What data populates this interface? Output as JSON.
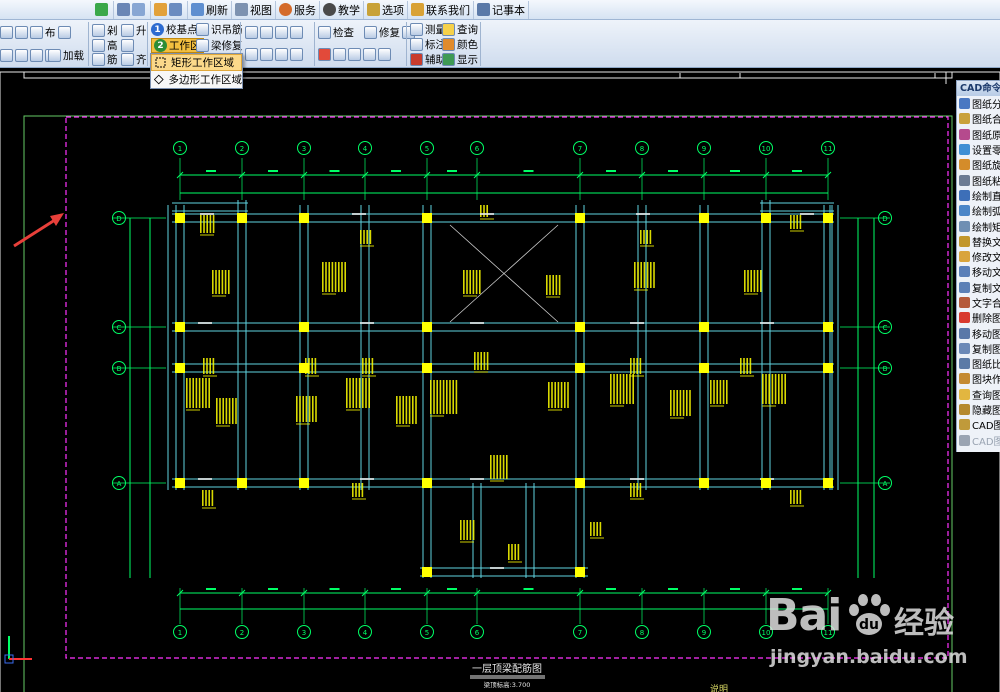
{
  "menubar": {
    "items": [
      {
        "label": "",
        "icon": "puzzle-icon"
      },
      {
        "label": "",
        "icon": "dimension-icon"
      },
      {
        "label": "",
        "icon": "window-icon"
      },
      {
        "label": "",
        "icon": "pencil-icon"
      },
      {
        "label": "刷新",
        "icon": "refresh-icon"
      },
      {
        "label": "视图",
        "icon": "view-icon"
      },
      {
        "label": "服务",
        "icon": "service-icon"
      },
      {
        "label": "教学",
        "icon": "teaching-icon"
      },
      {
        "label": "选项",
        "icon": "options-icon"
      },
      {
        "label": "联系我们",
        "icon": "contact-icon"
      },
      {
        "label": "记事本",
        "icon": "notepad-icon"
      }
    ]
  },
  "ribbon": {
    "group1": {
      "row1": [
        "剁",
        "升"
      ],
      "row2": [
        "高",
        "加载"
      ],
      "row3": [
        "筋",
        "齐"
      ]
    },
    "steps": {
      "step1": {
        "num": "1",
        "label": "校基点"
      },
      "step2": {
        "num": "2",
        "label": "工作区"
      },
      "recognize": "识吊筋",
      "beam_repair": "梁修复"
    },
    "tools": {
      "check": "检查",
      "repair": "修复"
    },
    "right": {
      "measure": "测量",
      "query": "查询",
      "annotate": "标注",
      "color": "颜色",
      "assist": "辅助",
      "display": "显示"
    }
  },
  "dropdown": {
    "items": [
      {
        "label": "矩形工作区域",
        "active": true
      },
      {
        "label": "多边形工作区域",
        "active": false
      }
    ]
  },
  "drawing": {
    "title": "一层顶梁配筋图",
    "subtitle": "梁顶标高:3.700",
    "note": "说明",
    "top_axes": [
      "1",
      "2",
      "3",
      "4",
      "5",
      "6",
      "7",
      "8",
      "9",
      "10",
      "11"
    ],
    "left_axes": [
      "D",
      "C",
      "B",
      "A"
    ],
    "right_axes": [
      "D",
      "C",
      "B",
      "A"
    ]
  },
  "cad_panel": {
    "title": "CAD命令",
    "items": [
      {
        "label": "图纸分",
        "icon": "split-icon"
      },
      {
        "label": "图纸合",
        "icon": "merge-icon"
      },
      {
        "label": "图纸原",
        "icon": "origin-icon"
      },
      {
        "label": "设置零",
        "icon": "zero-icon"
      },
      {
        "label": "图纸旋",
        "icon": "rotate-icon"
      },
      {
        "label": "图纸粘",
        "icon": "paste-icon"
      },
      {
        "label": "绘制直",
        "icon": "line-icon"
      },
      {
        "label": "绘制弧",
        "icon": "arc-icon"
      },
      {
        "label": "绘制矩",
        "icon": "rect-icon"
      },
      {
        "label": "替换文",
        "icon": "replace-text-icon"
      },
      {
        "label": "修改文",
        "icon": "edit-text-icon"
      },
      {
        "label": "移动文",
        "icon": "move-text-icon"
      },
      {
        "label": "复制文",
        "icon": "copy-text-icon"
      },
      {
        "label": "文字合",
        "icon": "merge-text-icon"
      },
      {
        "label": "删除图",
        "icon": "delete-icon"
      },
      {
        "label": "移动图",
        "icon": "move-icon"
      },
      {
        "label": "复制图",
        "icon": "copy-icon"
      },
      {
        "label": "图纸比",
        "icon": "scale-icon"
      },
      {
        "label": "图块作",
        "icon": "block-icon"
      },
      {
        "label": "查询图",
        "icon": "query-icon"
      },
      {
        "label": "隐藏图",
        "icon": "hide-icon"
      },
      {
        "label": "CAD图层",
        "icon": "layers-icon"
      },
      {
        "label": "CAD图层",
        "icon": "layers-disabled-icon",
        "disabled": true
      }
    ]
  },
  "watermark": {
    "brand": "Bai",
    "brand_cn": "经验",
    "url": "jingyan.baidu.com"
  },
  "colors": {
    "ribbon_bg": "#d6e3f3",
    "highlight": "#f3bf3f",
    "cad_axis": "#00ff66",
    "cad_beam": "#5fd3e0",
    "cad_column": "#ffff00",
    "cad_text": "#ffff00",
    "work_area": "#ff33ff",
    "arrow": "#e8403a"
  }
}
